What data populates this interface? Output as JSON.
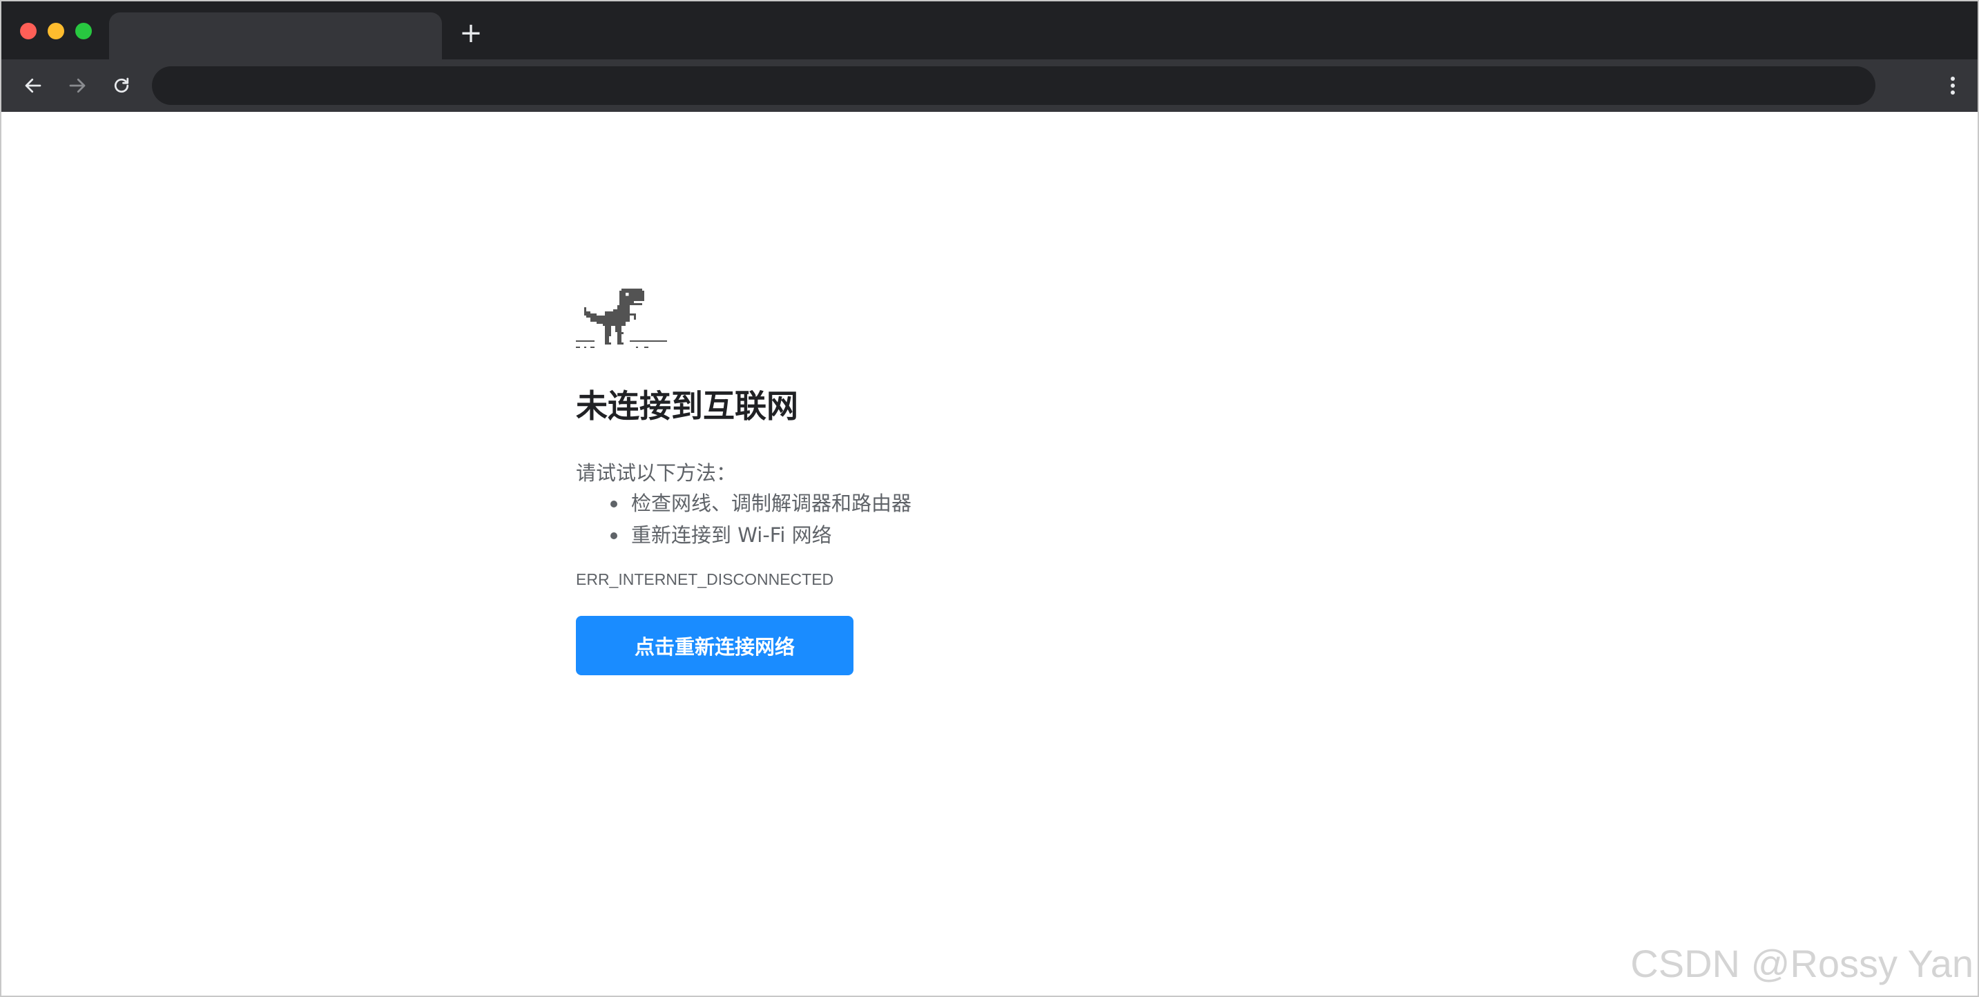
{
  "browser": {
    "tab_title": "",
    "new_tab_symbol": "+",
    "address": ""
  },
  "page": {
    "title": "未连接到互联网",
    "hint": "请试试以下方法：",
    "suggestions": [
      "检查网线、调制解调器和路由器",
      "重新连接到 Wi-Fi 网络"
    ],
    "error_code": "ERR_INTERNET_DISCONNECTED",
    "button_label": "点击重新连接网络"
  },
  "watermark": "CSDN @Rossy Yan",
  "colors": {
    "titlebar": "#202124",
    "toolbar": "#35363a",
    "button": "#1a8cff",
    "dino": "#535353"
  },
  "icons": {
    "back": "arrow-left-icon",
    "forward": "arrow-right-icon",
    "reload": "reload-icon",
    "menu": "kebab-menu-icon",
    "dino": "t-rex-dino-icon"
  }
}
